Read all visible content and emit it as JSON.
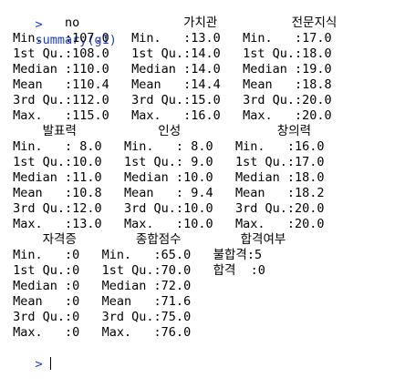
{
  "console": {
    "prompt": ">",
    "command": "summary(g1)",
    "output_lines": [
      "        no              가치관          전문지식    ",
      " Min.   :107.0   Min.   :13.0   Min.   :17.0  ",
      " 1st Qu.:108.0   1st Qu.:14.0   1st Qu.:18.0  ",
      " Median :110.0   Median :14.0   Median :19.0  ",
      " Mean   :110.4   Mean   :14.4   Mean   :18.8  ",
      " 3rd Qu.:112.0   3rd Qu.:15.0   3rd Qu.:20.0  ",
      " Max.   :115.0   Max.   :16.0   Max.   :20.0  ",
      "     발표력           인성             창의력     ",
      " Min.   : 8.0   Min.   : 8.0   Min.   :16.0  ",
      " 1st Qu.:10.0   1st Qu.: 9.0   1st Qu.:17.0  ",
      " Median :11.0   Median :10.0   Median :18.0  ",
      " Mean   :10.8   Mean   : 9.4   Mean   :18.2  ",
      " 3rd Qu.:12.0   3rd Qu.:10.0   3rd Qu.:20.0  ",
      " Max.   :13.0   Max.   :10.0   Max.   :20.0  ",
      "     자격증        종합점수        합격여부  ",
      " Min.   :0   Min.   :65.0   불합격:5   ",
      " 1st Qu.:0   1st Qu.:70.0   합격  :0   ",
      " Median :0   Median :72.0              ",
      " Mean   :0   Mean   :71.6              ",
      " 3rd Qu.:0   3rd Qu.:75.0              ",
      " Max.   :0   Max.   :76.0              "
    ],
    "next_prompt": ">"
  },
  "colors": {
    "prompt": "#1a3cc8",
    "output": "#000000",
    "background": "#ffffff"
  }
}
